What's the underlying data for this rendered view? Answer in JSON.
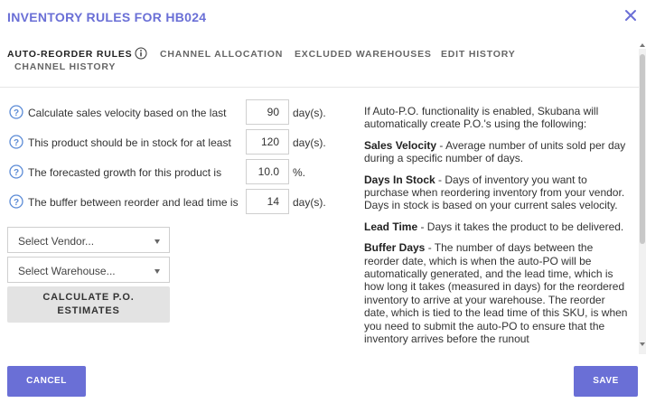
{
  "dialog": {
    "title": "INVENTORY RULES FOR HB024",
    "close_icon": "close-icon"
  },
  "tabs": [
    {
      "label": "AUTO-REORDER RULES",
      "active": true
    },
    {
      "label": "CHANNEL ALLOCATION",
      "active": false
    },
    {
      "label": "EXCLUDED WAREHOUSES",
      "active": false
    },
    {
      "label": "EDIT HISTORY",
      "active": false
    },
    {
      "label": "CHANNEL HISTORY",
      "active": false
    }
  ],
  "rules": [
    {
      "label": "Calculate sales velocity based on the last",
      "value": "90",
      "unit": "day(s)."
    },
    {
      "label": "This product should be in stock for at least",
      "value": "120",
      "unit": "day(s)."
    },
    {
      "label": "The forecasted growth for this product is",
      "value": "10.0",
      "unit": "%."
    },
    {
      "label": "The buffer between reorder and lead time is",
      "value": "14",
      "unit": "day(s)."
    }
  ],
  "vendor_select": {
    "label": "Select Vendor..."
  },
  "warehouse_select": {
    "label": "Select Warehouse..."
  },
  "calculate_button": {
    "line1": "CALCULATE P.O.",
    "line2": "ESTIMATES"
  },
  "help": {
    "intro": "If Auto-P.O. functionality is enabled, Skubana will automatically create P.O.'s using the following:",
    "items": [
      {
        "term": "Sales Velocity",
        "desc": " - Average number of units sold per day during a specific number of days."
      },
      {
        "term": "Days In Stock",
        "desc": " - Days of inventory you want to purchase when reordering inventory from your vendor. Days in stock is based on your current sales velocity."
      },
      {
        "term": "Lead Time",
        "desc": " - Days it takes the product to be delivered."
      },
      {
        "term": "Buffer Days",
        "desc": " - The number of days between the reorder date, which is when the auto-PO will be automatically generated, and the lead time, which is how long it takes (measured in days) for the reordered inventory to arrive at your warehouse. The reorder date, which is tied to the lead time of this SKU, is when you need to submit the auto-PO to ensure that the inventory arrives before the runout"
      }
    ]
  },
  "footer": {
    "cancel_label": "CANCEL",
    "save_label": "SAVE"
  },
  "colors": {
    "accent": "#6a6fd6",
    "icon_blue": "#5b8bd6"
  }
}
